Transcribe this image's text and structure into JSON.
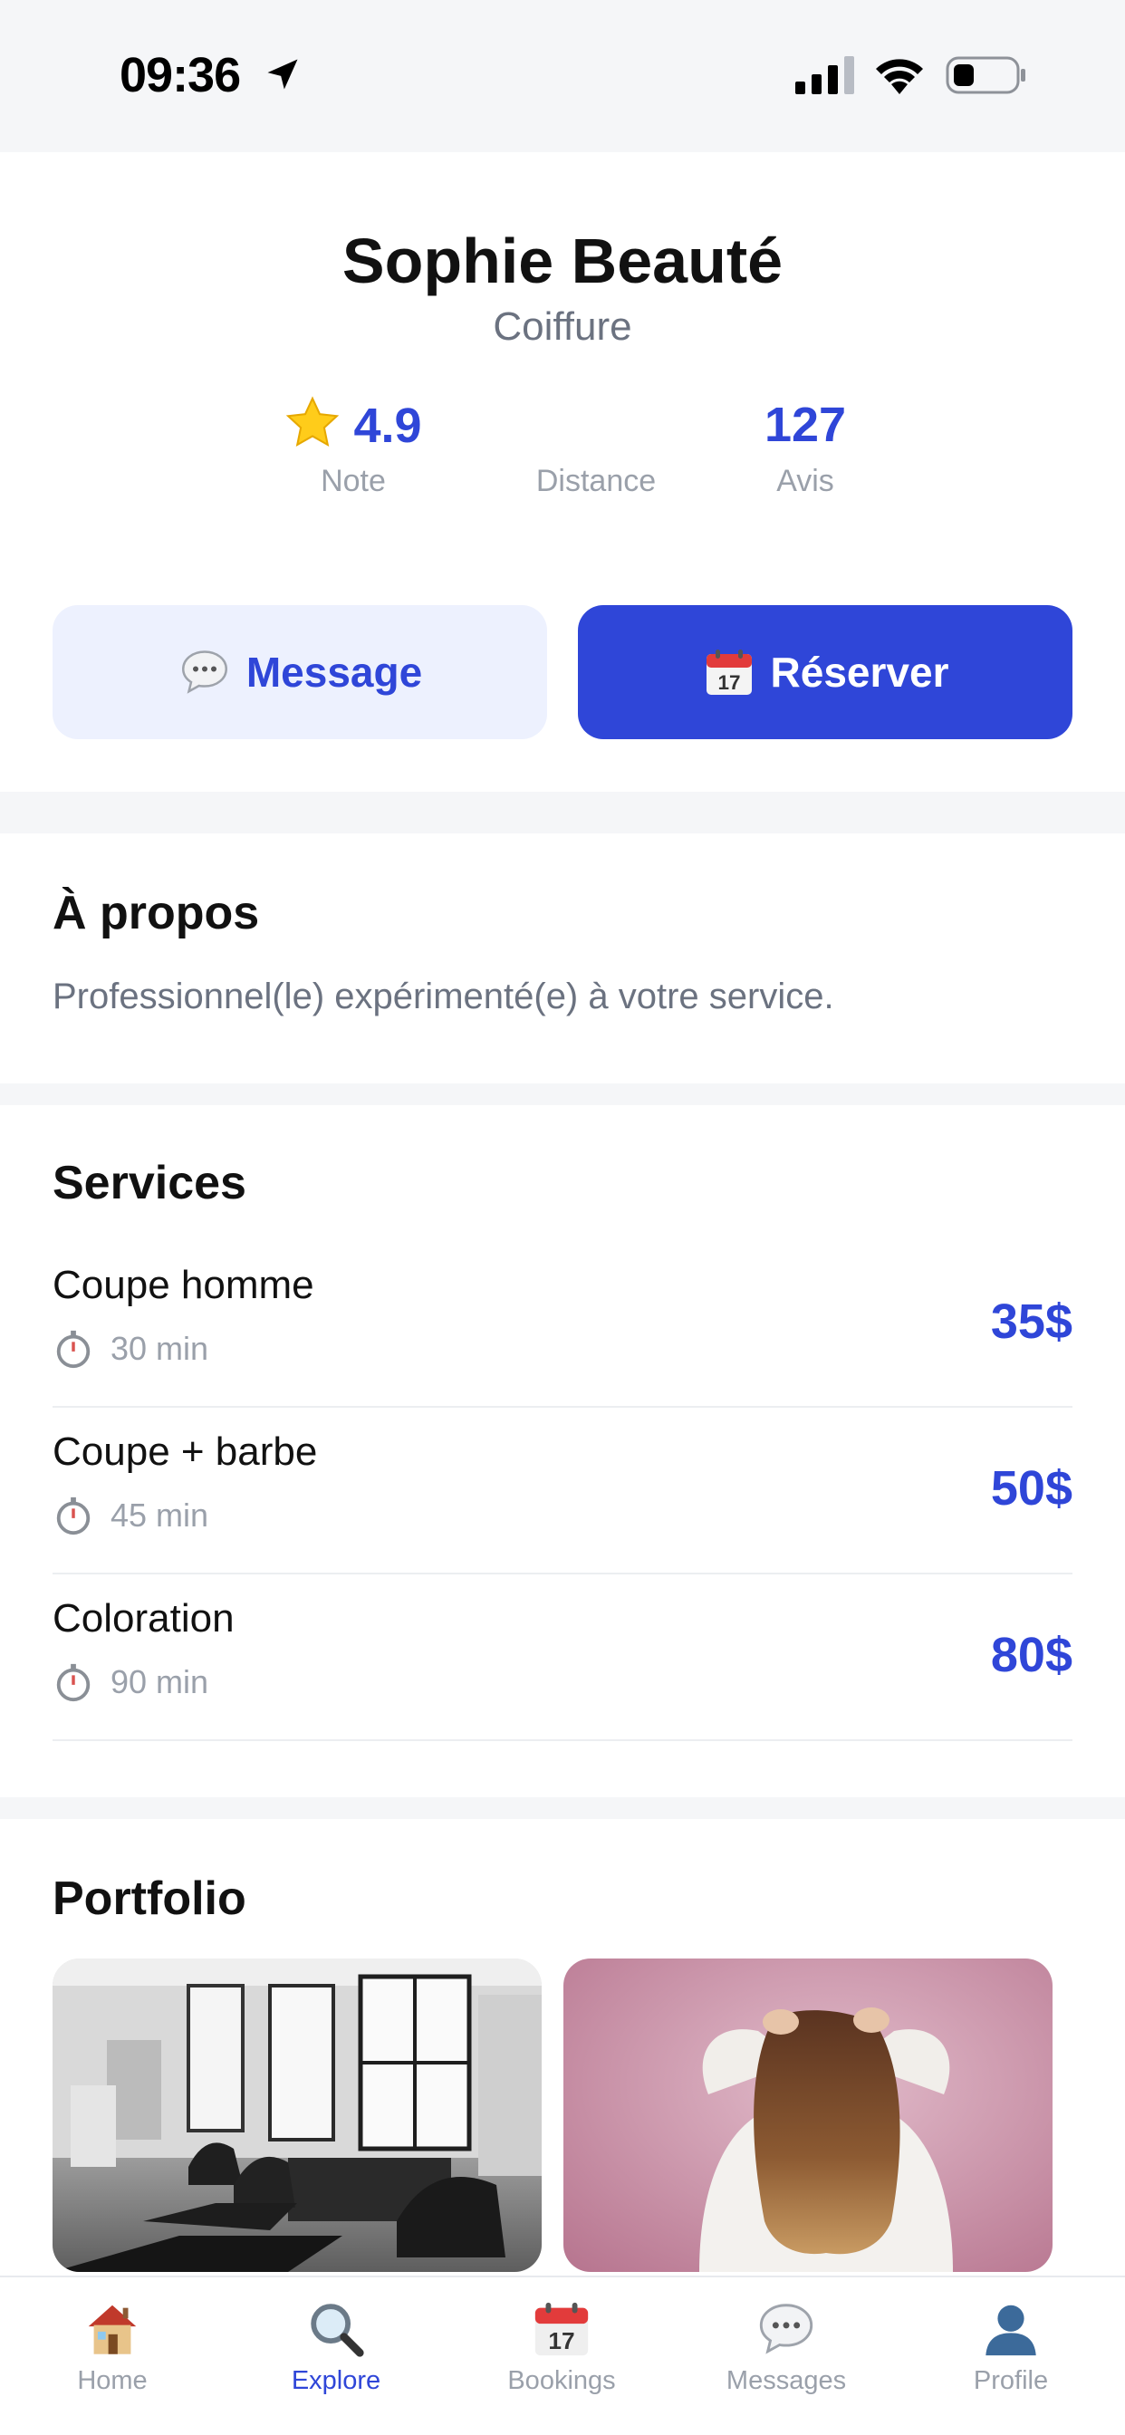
{
  "status_bar": {
    "time": "09:36"
  },
  "provider": {
    "name": "Sophie Beauté",
    "category": "Coiffure",
    "stats": {
      "rating_value": "4.9",
      "rating_label": "Note",
      "distance_value": "",
      "distance_label": "Distance",
      "reviews_value": "127",
      "reviews_label": "Avis"
    }
  },
  "actions": {
    "message_label": "Message",
    "reserve_label": "Réserver"
  },
  "about": {
    "title": "À propos",
    "text": "Professionnel(le) expérimenté(e) à votre service."
  },
  "services": {
    "title": "Services",
    "items": [
      {
        "name": "Coupe homme",
        "duration": "30 min",
        "price": "35$"
      },
      {
        "name": "Coupe + barbe",
        "duration": "45 min",
        "price": "50$"
      },
      {
        "name": "Coloration",
        "duration": "90 min",
        "price": "80$"
      }
    ]
  },
  "portfolio": {
    "title": "Portfolio"
  },
  "tab_bar": {
    "items": [
      {
        "label": "Home",
        "icon": "house-icon"
      },
      {
        "label": "Explore",
        "icon": "magnifier-icon",
        "active": true
      },
      {
        "label": "Bookings",
        "icon": "calendar-icon"
      },
      {
        "label": "Messages",
        "icon": "speech-bubble-icon"
      },
      {
        "label": "Profile",
        "icon": "person-silhouette-icon"
      }
    ]
  },
  "colors": {
    "accent": "#2f46d8",
    "accent_light": "#edf1fe",
    "muted_text": "#9aa0aa",
    "secondary_text": "#6b7280",
    "section_gap": "#f5f6f8"
  }
}
